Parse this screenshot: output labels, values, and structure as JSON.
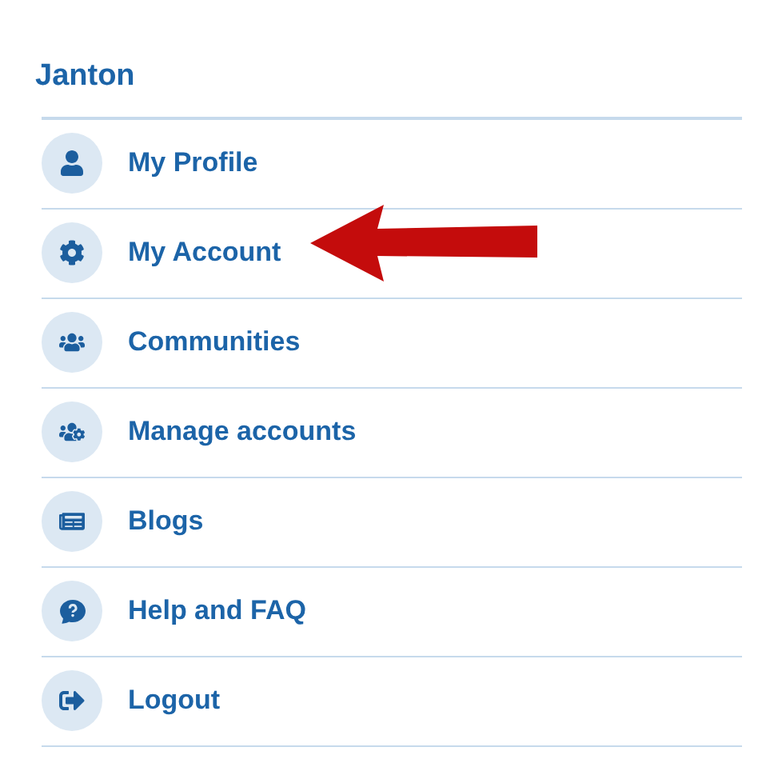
{
  "title": "Janton",
  "menu": [
    {
      "label": "My Profile"
    },
    {
      "label": "My Account"
    },
    {
      "label": "Communities"
    },
    {
      "label": "Manage accounts"
    },
    {
      "label": "Blogs"
    },
    {
      "label": "Help and FAQ"
    },
    {
      "label": "Logout"
    }
  ]
}
